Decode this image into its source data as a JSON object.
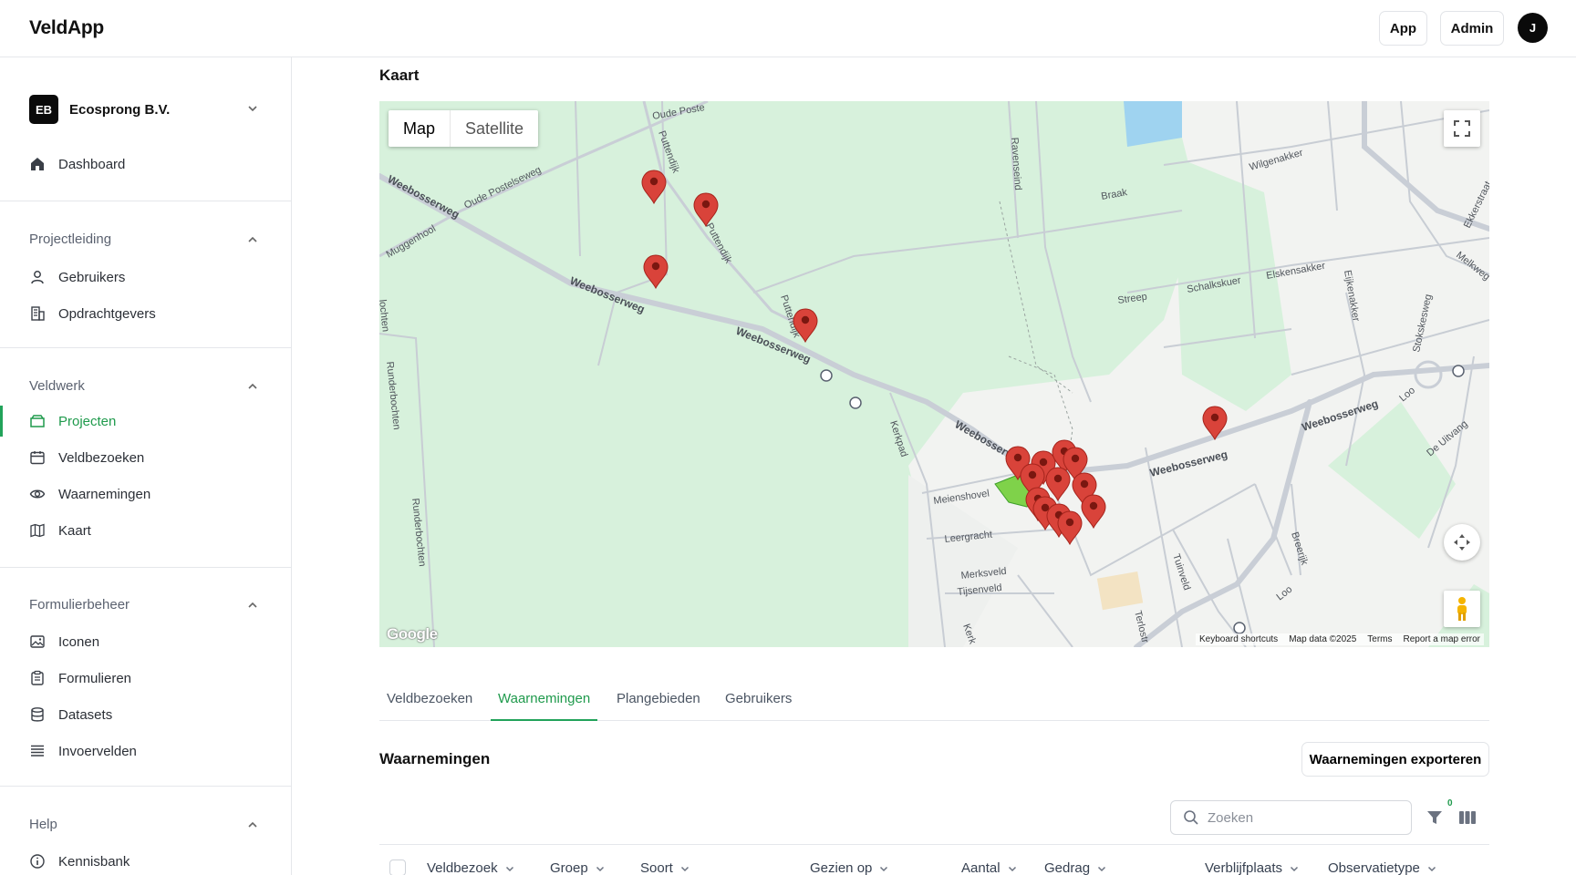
{
  "app": {
    "name": "VeldApp",
    "buttons": {
      "app": "App",
      "admin": "Admin"
    },
    "avatar_initial": "J"
  },
  "sidebar": {
    "org": {
      "initials": "EB",
      "name": "Ecosprong B.V."
    },
    "top_items": [
      {
        "label": "Dashboard",
        "icon": "home-icon"
      }
    ],
    "sections": [
      {
        "title": "Projectleiding",
        "items": [
          {
            "label": "Gebruikers",
            "icon": "user-icon"
          },
          {
            "label": "Opdrachtgevers",
            "icon": "building-icon"
          }
        ]
      },
      {
        "title": "Veldwerk",
        "items": [
          {
            "label": "Projecten",
            "icon": "folder-icon",
            "active": true
          },
          {
            "label": "Veldbezoeken",
            "icon": "calendar-icon"
          },
          {
            "label": "Waarnemingen",
            "icon": "eye-icon"
          },
          {
            "label": "Kaart",
            "icon": "map-icon"
          }
        ]
      },
      {
        "title": "Formulierbeheer",
        "items": [
          {
            "label": "Iconen",
            "icon": "image-icon"
          },
          {
            "label": "Formulieren",
            "icon": "clipboard-icon"
          },
          {
            "label": "Datasets",
            "icon": "database-icon"
          },
          {
            "label": "Invoervelden",
            "icon": "list-icon"
          }
        ]
      },
      {
        "title": "Help",
        "items": [
          {
            "label": "Kennisbank",
            "icon": "info-icon"
          }
        ]
      }
    ]
  },
  "main": {
    "map_title": "Kaart",
    "map": {
      "toggle": {
        "map": "Map",
        "satellite": "Satellite"
      },
      "google": "Google",
      "footer": {
        "shortcuts": "Keyboard shortcuts",
        "data": "Map data ©2025",
        "terms": "Terms",
        "report": "Report a map error"
      },
      "streets": {
        "weebosserweg": "Weebosserweg",
        "oude_postelseweg": "Oude Postelseweg",
        "oude_post": "Oude Poste",
        "muggenhool": "Muggenhool",
        "puttendijk": "Puttendijk",
        "ravenseind": "Ravenseind",
        "braak": "Braak",
        "wilgenakker": "Wilgenakker",
        "ekkersstraat": "Ekkerstraat",
        "melkweg": "Melkweg",
        "elskensakker": "Elskensakker",
        "schalkskuer": "Schalkskuer",
        "eijkenakker": "Eijkenakker",
        "streep": "Streep",
        "stokskesweg": "Stokskesweg",
        "loo": "Loo",
        "de_uitvang": "De Uitvang",
        "kerkpad": "Kerkpad",
        "meienshovel": "Meienshovel",
        "leergracht": "Leergracht",
        "merksveld": "Merksveld",
        "tijsenveld": "Tijsenveld",
        "tuinveld": "Tuinveld",
        "breerijk": "Breerijk",
        "runderbochten": "Runderbochten",
        "lochten": "lochten",
        "kerk": "Kerk",
        "terlostr": "Terlostr"
      }
    },
    "tabs": [
      "Veldbezoeken",
      "Waarnemingen",
      "Plangebieden",
      "Gebruikers"
    ],
    "active_tab": "Waarnemingen",
    "section_title": "Waarnemingen",
    "export_label": "Waarnemingen exporteren",
    "search_placeholder": "Zoeken",
    "filter_count": "0",
    "columns": [
      "Veldbezoek",
      "Groep",
      "Soort",
      "Gezien op",
      "Aantal",
      "Gedrag",
      "Verblijfplaats",
      "Observatietype"
    ]
  },
  "colors": {
    "accent": "#22a35a",
    "marker": "#d9433a",
    "map_park": "#d7f1dc",
    "map_road": "#c9ced6"
  }
}
